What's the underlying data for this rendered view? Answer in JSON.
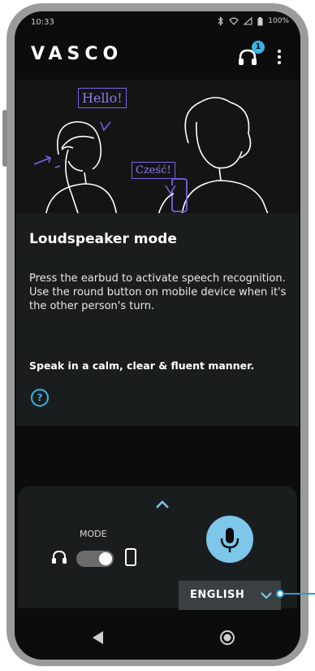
{
  "status_bar": {
    "time": "10:33",
    "battery_percent": "100%",
    "icons": [
      "bluetooth-icon",
      "wifi-icon",
      "signal-icon",
      "battery-icon"
    ]
  },
  "app_bar": {
    "logo": "VASCO",
    "headset_badge_count": "1"
  },
  "illustration": {
    "bubble_left": "Hello!",
    "bubble_right": "Cześć!"
  },
  "card": {
    "title": "Loudspeaker mode",
    "description": "Press the earbud to activate speech recognition. Use the round button on mobile device when it's the other person's turn.",
    "tip": "Speak in a calm, clear & fluent manner.",
    "help_icon": "?"
  },
  "bottom_panel": {
    "mode_label": "MODE",
    "mode_toggle_on": true,
    "language": "ENGLISH"
  },
  "colors": {
    "accent": "#39b3e6",
    "mic_button": "#7cc7ea",
    "bubble_stroke": "#7a63e6",
    "background": "#0c0c0c",
    "card": "#1a1d1e"
  }
}
